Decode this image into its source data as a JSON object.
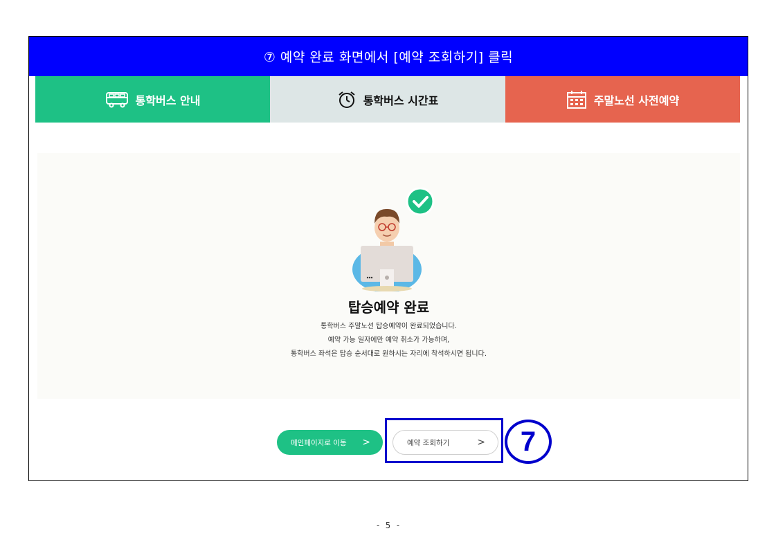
{
  "banner": {
    "text": "⑦ 예약 완료 화면에서 [예약 조회하기] 클릭"
  },
  "tabs": [
    {
      "label": "통학버스 안내",
      "icon": "bus-icon"
    },
    {
      "label": "통학버스 시간표",
      "icon": "alarm-clock-icon"
    },
    {
      "label": "주말노선 사전예약",
      "icon": "calendar-icon"
    }
  ],
  "colors": {
    "banner": "#0000ff",
    "tab_green": "#1ec185",
    "tab_gray": "#dde6e6",
    "tab_red": "#e6644f",
    "highlight": "#0000cc"
  },
  "result": {
    "title": "탑승예약 완료",
    "lines": [
      "통학버스 주말노선 탑승예약이 완료되었습니다.",
      "예약 가능 일자에만 예약 취소가 가능하며,",
      "통학버스 좌석은 탑승 순서대로 원하시는 자리에 착석하시면 됩니다."
    ]
  },
  "buttons": {
    "main": {
      "label": "메인페이지로 이동",
      "arrow": ">"
    },
    "check": {
      "label": "예약 조회하기",
      "arrow": ">"
    }
  },
  "step_mark": "7",
  "page_number": "- 5 -"
}
